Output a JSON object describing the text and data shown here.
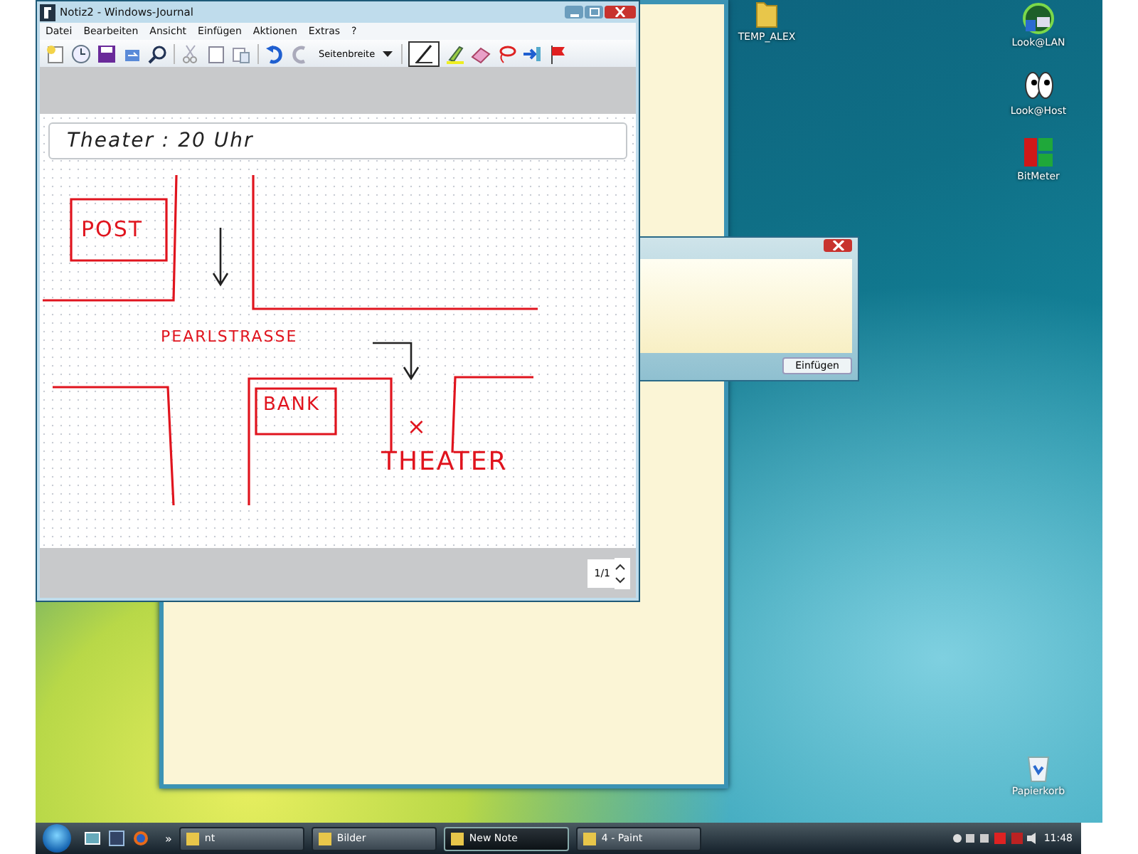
{
  "journal": {
    "title": "Notiz2 - Windows-Journal",
    "menu": [
      "Datei",
      "Bearbeiten",
      "Ansicht",
      "Einfügen",
      "Aktionen",
      "Extras",
      "?"
    ],
    "view_dropdown": "Seitenbreite",
    "title_line": "Theater : 20 Uhr",
    "ink_labels": [
      "POST",
      "PEARLSTRASSE",
      "BANK",
      "×",
      "THEATER"
    ],
    "page_indicator": "1/1"
  },
  "note_dialog": {
    "button": "Einfügen"
  },
  "desktop_icons": [
    {
      "label": "TEMP_ALEX",
      "kind": "folder"
    },
    {
      "label": "Look@LAN",
      "kind": "radar"
    },
    {
      "label": "Look@Host",
      "kind": "eyes"
    },
    {
      "label": "BitMeter",
      "kind": "meter"
    },
    {
      "label": "Papierkorb",
      "kind": "bin"
    }
  ],
  "taskbar": {
    "overflow": "»",
    "tasks": [
      {
        "label": "nt",
        "selected": false
      },
      {
        "label": "Bilder",
        "selected": false
      },
      {
        "label": "New Note",
        "selected": true
      },
      {
        "label": "4 - Paint",
        "selected": false
      }
    ],
    "clock": "11:48"
  }
}
